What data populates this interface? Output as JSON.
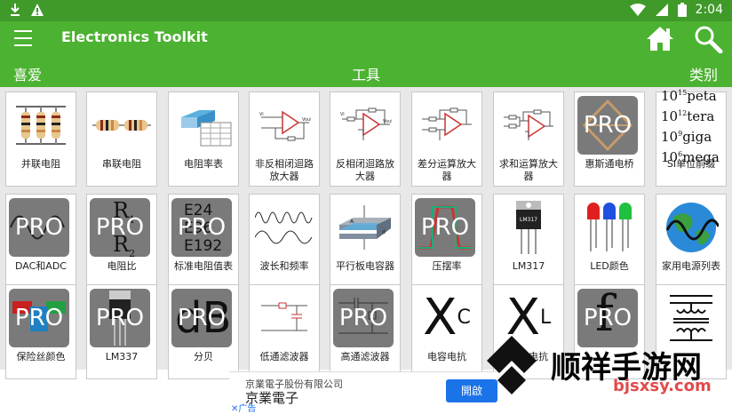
{
  "status": {
    "time": "2:04"
  },
  "app": {
    "title": "Electronics Toolkit"
  },
  "tabs": [
    "喜爱",
    "工具",
    "类别"
  ],
  "tools": [
    {
      "label": "并联电阻",
      "pro": false,
      "icon": "parallel-resistors"
    },
    {
      "label": "串联电阻",
      "pro": false,
      "icon": "series-resistors"
    },
    {
      "label": "电阻率表",
      "pro": false,
      "icon": "resistivity-table"
    },
    {
      "label": "非反相闭迴路\n放大器",
      "pro": false,
      "icon": "non-inverting-amp"
    },
    {
      "label": "反相闭迴路放\n大器",
      "pro": false,
      "icon": "inverting-amp"
    },
    {
      "label": "差分运算放大\n器",
      "pro": false,
      "icon": "differential-amp"
    },
    {
      "label": "求和运算放大\n器",
      "pro": false,
      "icon": "summing-amp"
    },
    {
      "label": "惠斯通电桥",
      "pro": true,
      "icon": "wheatstone-bridge"
    },
    {
      "label": "SI单位前缀",
      "pro": false,
      "icon": "si-prefix"
    },
    {
      "label": "DAC和ADC",
      "pro": true,
      "icon": "dac-adc"
    },
    {
      "label": "电阻比",
      "pro": true,
      "icon": "resistor-ratio"
    },
    {
      "label": "标准电阻值表",
      "pro": true,
      "icon": "standard-resistor"
    },
    {
      "label": "波长和频率",
      "pro": false,
      "icon": "wavelength"
    },
    {
      "label": "平行板电容器",
      "pro": false,
      "icon": "parallel-plate"
    },
    {
      "label": "压摆率",
      "pro": true,
      "icon": "slew-rate"
    },
    {
      "label": "LM317",
      "pro": false,
      "icon": "lm317"
    },
    {
      "label": "LED颜色",
      "pro": false,
      "icon": "led-color"
    },
    {
      "label": "家用电源列表",
      "pro": false,
      "icon": "mains-power"
    },
    {
      "label": "保险丝颜色",
      "pro": true,
      "icon": "fuse-color"
    },
    {
      "label": "LM337",
      "pro": true,
      "icon": "lm337"
    },
    {
      "label": "分贝",
      "pro": true,
      "icon": "decibel"
    },
    {
      "label": "低通滤波器",
      "pro": false,
      "icon": "low-pass"
    },
    {
      "label": "高通滤波器",
      "pro": true,
      "icon": "high-pass"
    },
    {
      "label": "电容电抗",
      "pro": false,
      "icon": "capacitive-reactance"
    },
    {
      "label": "感抗电抗",
      "pro": false,
      "icon": "inductive-reactance"
    },
    {
      "label": "",
      "pro": true,
      "icon": "frequency"
    },
    {
      "label": "",
      "pro": false,
      "icon": "transformer"
    }
  ],
  "pro_badge": "PRO",
  "si_prefixes": [
    {
      "exp": "15",
      "name": "peta"
    },
    {
      "exp": "12",
      "name": "tera"
    },
    {
      "exp": "9",
      "name": "giga"
    },
    {
      "exp": "6",
      "name": "mega"
    }
  ],
  "glyph_text": {
    "e24": "E24",
    "e96": "E96",
    "e192": "E192",
    "r1": "R",
    "r1_sub": "1",
    "r2": "R",
    "r2_sub": "2",
    "db": "dB",
    "xc": "X",
    "xc_sub": "C",
    "xl": "X",
    "xl_sub": "L",
    "f": "f",
    "lm317": "LM317"
  },
  "ad": {
    "company_small": "京業電子股份有限公司",
    "company": "京業電子",
    "button": "開啟",
    "tag": "广告"
  },
  "watermark": {
    "text": "顺祥手游网",
    "url": "bjsxsy.com"
  },
  "colors": {
    "statusbar": "#3f9a29",
    "appbar": "#4cb231",
    "grid_bg": "#e8e8e8",
    "pro_bg": "#7a7a7a"
  }
}
